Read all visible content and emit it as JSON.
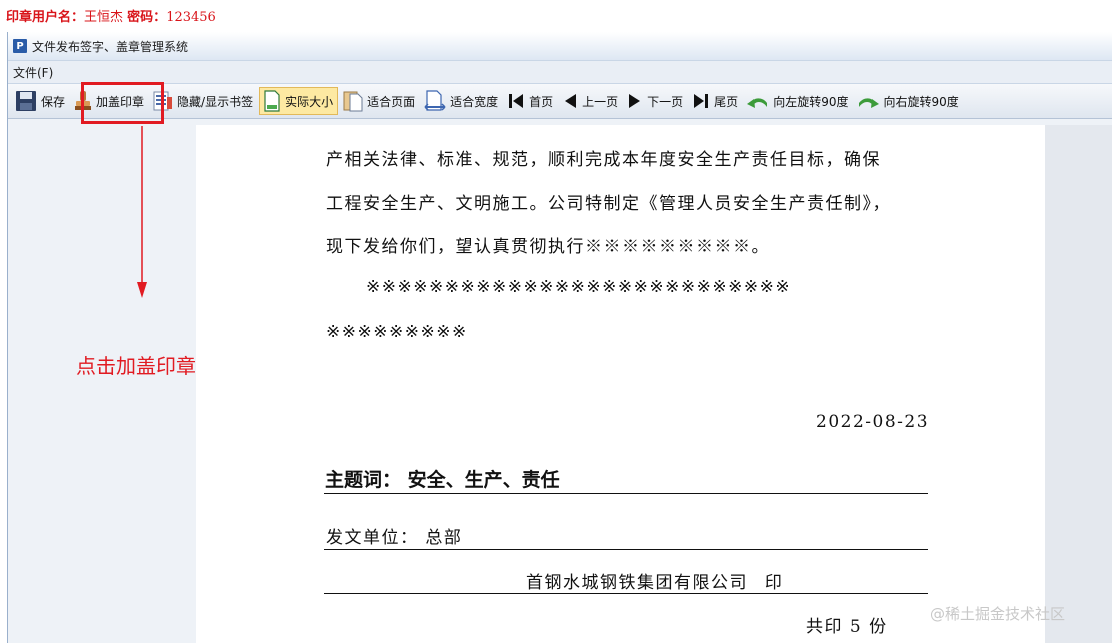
{
  "top_note": {
    "prefix": "印章用户名：",
    "username": "王恒杰",
    "password_label": "密码：",
    "password": "123456"
  },
  "window": {
    "icon_letter": "P",
    "title": "文件发布签字、盖章管理系统"
  },
  "menu": {
    "file": "文件(F)"
  },
  "toolbar": {
    "save": "保存",
    "add_seal": "加盖印章",
    "toggle_bookmark": "隐藏/显示书签",
    "actual_size": "实际大小",
    "fit_page": "适合页面",
    "fit_width": "适合宽度",
    "first_page": "首页",
    "prev_page": "上一页",
    "next_page": "下一页",
    "last_page": "尾页",
    "rotate_left": "向左旋转90度",
    "rotate_right": "向右旋转90度"
  },
  "annotation": {
    "text": "点击加盖印章",
    "color": "#e11b22"
  },
  "document": {
    "lines": [
      "产相关法律、标准、规范，顺利完成本年度安全生产责任目标，确保",
      "工程安全生产、文明施工。公司特制定《管理人员安全生产责任制》，",
      "现下发给你们，望认真贯彻执行※※※※※※※※※。",
      "※※※※※※※※※※※※※※※※※※※※※※※※※※※",
      "※※※※※※※※※"
    ],
    "date": "2022-08-23",
    "subject_label": "主题词：",
    "subject_value": "安全、生产、责任",
    "sender_label": "发文单位：",
    "sender_value": "总部",
    "issuer": "首钢水城钢铁集团有限公司",
    "issuer_suffix": "印",
    "copies": "共印 5 份"
  },
  "watermark": "@稀土掘金技术社区"
}
